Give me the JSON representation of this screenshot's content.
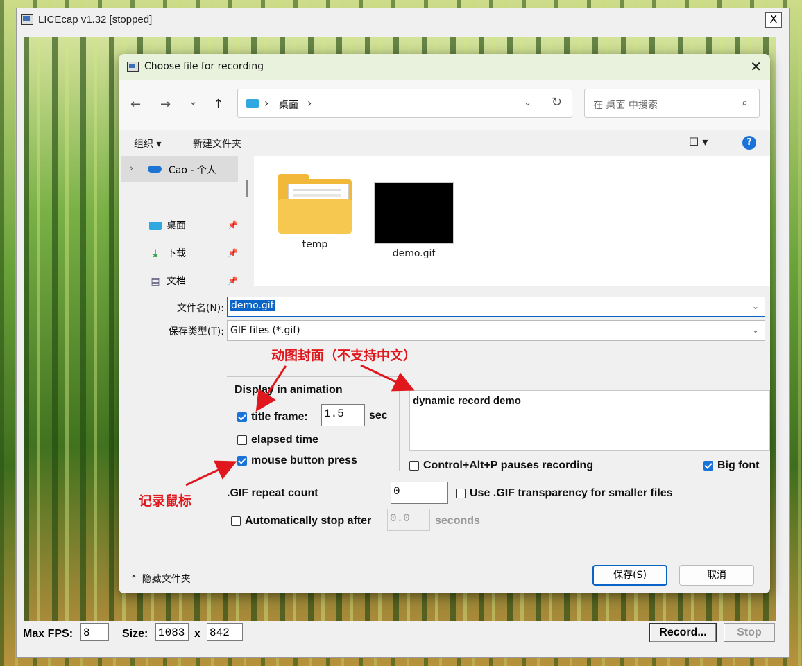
{
  "licecap": {
    "title": "LICEcap v1.32 [stopped]",
    "close": "X",
    "max_fps_label": "Max FPS:",
    "max_fps": "8",
    "size_label": "Size:",
    "width": "1083",
    "times": "x",
    "height": "842",
    "record_label": "Record...",
    "stop_label": "Stop"
  },
  "dialog": {
    "title": "Choose file for recording",
    "close": "✕",
    "nav": {
      "back": "←",
      "forward": "→",
      "recent": "⌄",
      "up": "↑"
    },
    "address": {
      "crumb": "桌面",
      "sep": "›",
      "dropdown": "⌄",
      "refresh": "↻"
    },
    "search_placeholder": "在 桌面 中搜索",
    "search_icon": "⌕",
    "organize": "组织 ▾",
    "new_folder": "新建文件夹",
    "view": "☐ ▾",
    "help": "?",
    "sidebar": {
      "cloud": "Cao - 个人",
      "items": [
        {
          "label": "桌面",
          "icon": "desktop-icon"
        },
        {
          "label": "下载",
          "icon": "download-icon"
        },
        {
          "label": "文档",
          "icon": "document-icon"
        }
      ]
    },
    "files": [
      {
        "name": "temp",
        "type": "folder"
      },
      {
        "name": "demo.gif",
        "type": "gif"
      }
    ],
    "filename_label": "文件名(N):",
    "filename_value": "demo.gif",
    "filetype_label": "保存类型(T):",
    "filetype_value": "GIF files (*.gif)",
    "hide_folders": "隐藏文件夹",
    "save": "保存(S)",
    "cancel": "取消"
  },
  "options": {
    "group_title": "Display in animation",
    "title_frame_label": "title frame:",
    "title_frame_checked": true,
    "title_frame_secs": "1.5",
    "sec_label": "sec",
    "elapsed_label": "elapsed time",
    "elapsed_checked": false,
    "mouse_label": "mouse button press",
    "mouse_checked": true,
    "title_text": "dynamic record demo",
    "pause_label": "Control+Alt+P pauses recording",
    "pause_checked": false,
    "bigfont_label": "Big font",
    "bigfont_checked": true,
    "repeat_label": ".GIF repeat count",
    "repeat_value": "0",
    "transparency_label": "Use .GIF transparency for smaller files",
    "transparency_checked": false,
    "autostop_label": "Automatically stop after",
    "autostop_checked": false,
    "autostop_value": "0.0",
    "seconds_label": "seconds"
  },
  "annotations": {
    "cover": "动图封面（不支持中文）",
    "mouse": "记录鼠标",
    "color": "#e0181d"
  }
}
